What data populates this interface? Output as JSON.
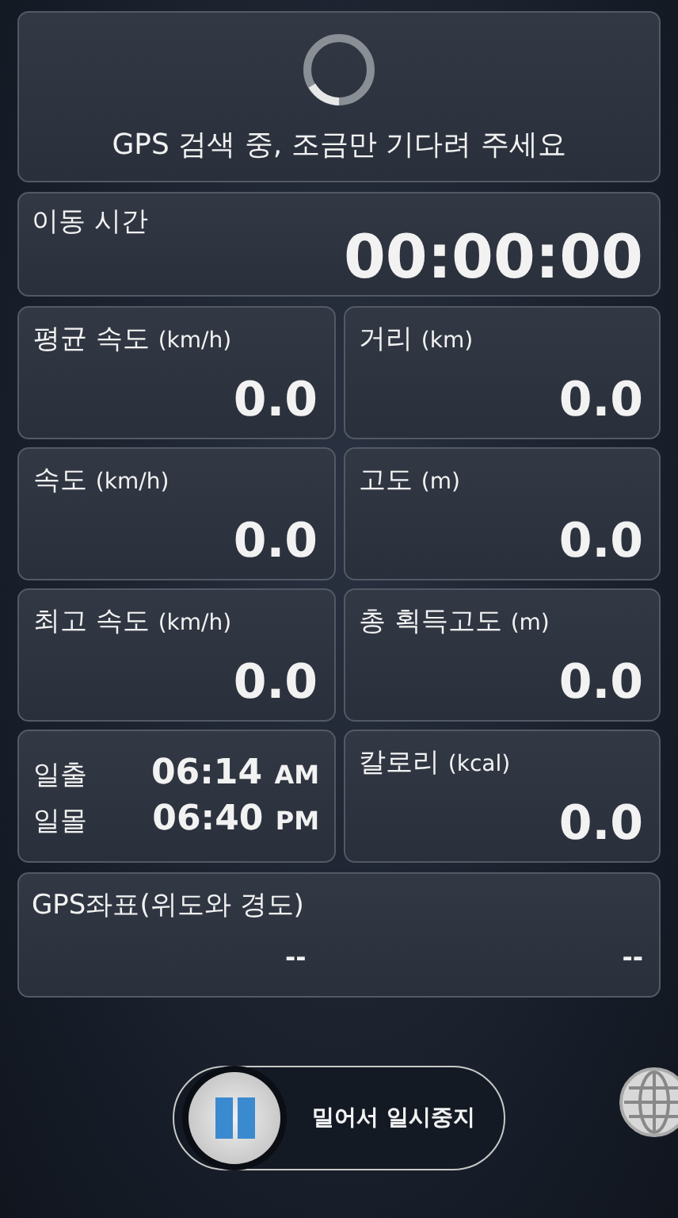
{
  "status": {
    "message": "GPS 검색 중, 조금만 기다려 주세요"
  },
  "moving_time": {
    "label": "이동 시간",
    "value": "00:00:00"
  },
  "cells": [
    {
      "kind": "stat",
      "label": "평균 속도",
      "unit": "(km/h)",
      "value": "0.0"
    },
    {
      "kind": "stat",
      "label": "거리",
      "unit": "(km)",
      "value": "0.0"
    },
    {
      "kind": "stat",
      "label": "속도",
      "unit": "(km/h)",
      "value": "0.0"
    },
    {
      "kind": "stat",
      "label": "고도",
      "unit": "(m)",
      "value": "0.0"
    },
    {
      "kind": "stat",
      "label": "최고 속도",
      "unit": "(km/h)",
      "value": "0.0"
    },
    {
      "kind": "stat",
      "label": "총 획득고도",
      "unit": "(m)",
      "value": "0.0"
    },
    {
      "kind": "sun",
      "rows": [
        {
          "label": "일출",
          "time": "06:14",
          "period": "AM"
        },
        {
          "label": "일몰",
          "time": "06:40",
          "period": "PM"
        }
      ]
    },
    {
      "kind": "stat",
      "label": "칼로리",
      "unit": "(kcal)",
      "value": "0.0"
    }
  ],
  "coordinates": {
    "label": "GPS좌표(위도와 경도)",
    "latitude": "--",
    "longitude": "--"
  },
  "slider": {
    "label": "밀어서 일시중지"
  }
}
